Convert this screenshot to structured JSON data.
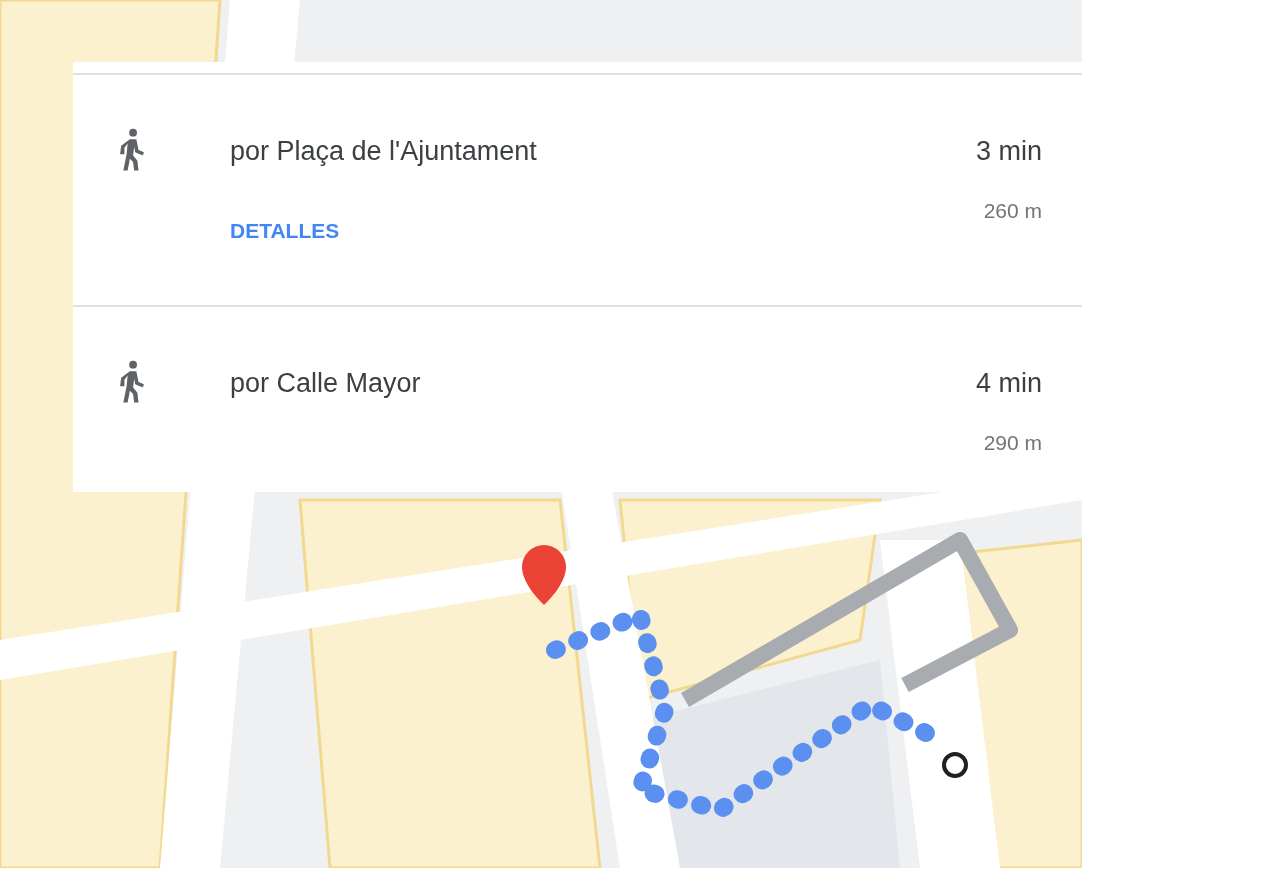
{
  "routes": [
    {
      "kind": "walk",
      "label": "por Plaça de l'Ajuntament",
      "time": "3 min",
      "distance": "260 m",
      "details": "DETALLES"
    },
    {
      "kind": "walk",
      "label": "por Calle Mayor",
      "time": "4 min",
      "distance": "290 m"
    }
  ]
}
